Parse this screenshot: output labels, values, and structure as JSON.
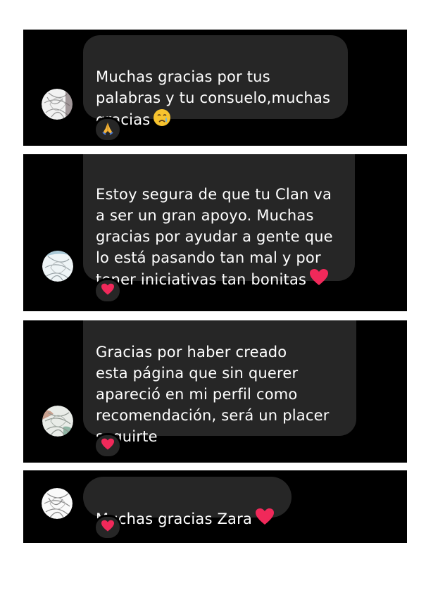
{
  "comments": [
    {
      "text": "Muchas gracias por tus\npalabras y tu consuelo,muchas\ngracias",
      "inline_emoji": "crying-face-icon",
      "reaction": "folded-hands-icon"
    },
    {
      "text": "Estoy segura de que tu Clan va\na ser un gran apoyo. Muchas\ngracias por ayudar a gente que\nlo está pasando tan mal y por\ntener iniciativas tan bonitas",
      "inline_emoji": "heart-icon",
      "reaction": "heart-icon"
    },
    {
      "text": "Gracias por haber creado\nesta página que sin querer\napareció en mi perfil como\nrecomendación,  será un placer\nseguirte",
      "inline_emoji": "",
      "reaction": "heart-icon"
    },
    {
      "text": "Muchas gracias Zara",
      "inline_emoji": "heart-icon",
      "reaction": "heart-icon"
    }
  ],
  "colors": {
    "panel_background": "#000000",
    "bubble_background": "#262626",
    "text": "#ffffff",
    "heart": "#f0295a"
  }
}
